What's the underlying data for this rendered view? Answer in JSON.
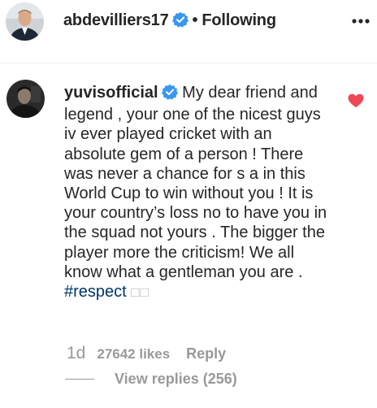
{
  "post": {
    "username": "abdevilliers17",
    "separator": "•",
    "follow_status": "Following",
    "more_icon": "more-horizontal-icon"
  },
  "comment": {
    "username": "yuvisofficial",
    "text": " My dear friend and legend , your one of the nicest guys iv ever played cricket with an absolute gem of a person ! There was never a chance for s a in this World Cup to win without you ! It is your country’s loss no to have you in the squad not yours . The bigger the player more the criticism! We all know what a gentleman you are . ",
    "hashtag": "#respect",
    "trailing_glyphs": "□□",
    "age": "1d",
    "likes": "27642 likes",
    "reply_label": "Reply",
    "view_replies": "View replies (256)",
    "liked": true
  },
  "colors": {
    "verified_blue": "#3897f0",
    "heart_red": "#ed4956",
    "hashtag": "#003569",
    "meta_gray": "#999999"
  }
}
